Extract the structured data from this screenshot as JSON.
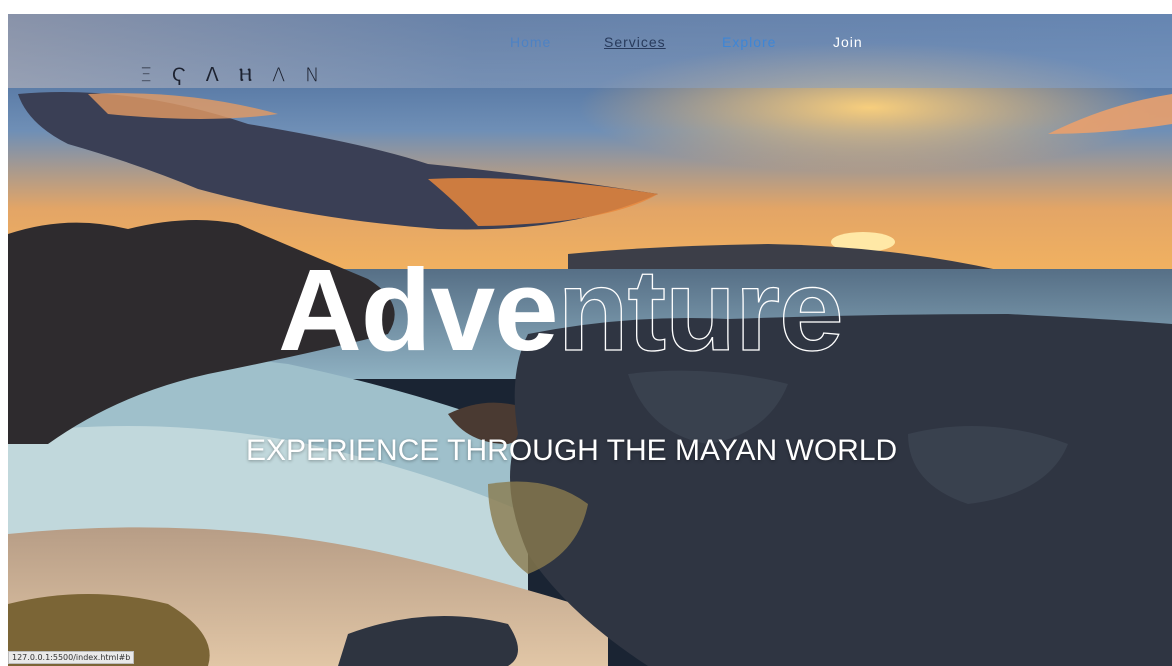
{
  "header": {
    "logo_text": "Ξ Ҁ ᐱ Ⲏ Λ Ν",
    "nav": {
      "home": "Home",
      "services": "Services",
      "explore": "Explore",
      "join": "Join"
    }
  },
  "hero": {
    "title_solid": "Adve",
    "title_outline": "nture",
    "subtitle": "EXPERIENCE THROUGH THE MAYAN WORLD",
    "background": "sunset-beach-photo"
  },
  "status_bar": {
    "url": "127.0.0.1:5500/index.html#b"
  }
}
